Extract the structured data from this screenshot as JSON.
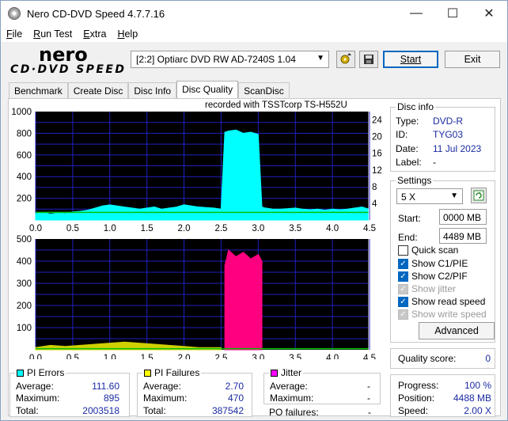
{
  "window": {
    "title": "Nero CD-DVD Speed 4.7.7.16",
    "minimize": "—",
    "maximize": "☐",
    "close": "✕"
  },
  "menu": [
    {
      "label": "File",
      "key": "F",
      "rest": "ile"
    },
    {
      "label": "Run Test",
      "key": "R",
      "rest": "un Test"
    },
    {
      "label": "Extra",
      "key": "E",
      "rest": "xtra"
    },
    {
      "label": "Help",
      "key": "H",
      "rest": "elp"
    }
  ],
  "logo": {
    "top": "nero",
    "bottom": "CD·DVD SPEED"
  },
  "toolbar": {
    "drive": "[2:2]  Optiarc DVD RW AD-7240S 1.04",
    "start_label": "Start",
    "exit_label": "Exit",
    "eject_icon": "eject-icon",
    "save_icon": "save-icon"
  },
  "tabs": [
    "Benchmark",
    "Create Disc",
    "Disc Info",
    "Disc Quality",
    "ScanDisc"
  ],
  "active_tab": "Disc Quality",
  "chart_data": [
    {
      "type": "area",
      "title": "recorded with TSSTcorp TS-H552U",
      "x_ticks": [
        "0.0",
        "0.5",
        "1.0",
        "1.5",
        "2.0",
        "2.5",
        "3.0",
        "3.5",
        "4.0",
        "4.5"
      ],
      "xlim": [
        0,
        4.5
      ],
      "y_ticks_left": [
        "1000",
        "800",
        "600",
        "400",
        "200"
      ],
      "ylim": [
        0,
        1000
      ],
      "y_ticks_right": [
        "24",
        "20",
        "16",
        "12",
        "8",
        "4"
      ],
      "y2lim": [
        0,
        26
      ],
      "grid": true,
      "series": [
        {
          "color": "#00ffff",
          "x": [
            0.0,
            0.1,
            0.2,
            0.3,
            0.4,
            0.5,
            0.6,
            0.7,
            0.8,
            0.9,
            1.0,
            1.1,
            1.2,
            1.3,
            1.4,
            1.5,
            1.6,
            1.7,
            1.8,
            1.9,
            2.0,
            2.1,
            2.2,
            2.3,
            2.4,
            2.5,
            2.55,
            2.6,
            2.7,
            2.8,
            2.9,
            3.0,
            3.05,
            3.1,
            3.2,
            3.3,
            3.4,
            3.5,
            3.6,
            3.7,
            3.8,
            3.9,
            4.0,
            4.1,
            4.2,
            4.3,
            4.4,
            4.49
          ],
          "y": [
            60,
            70,
            55,
            65,
            60,
            75,
            80,
            90,
            110,
            130,
            140,
            130,
            120,
            110,
            100,
            110,
            120,
            100,
            110,
            120,
            140,
            130,
            120,
            115,
            110,
            100,
            810,
            820,
            830,
            800,
            810,
            790,
            120,
            110,
            100,
            100,
            105,
            110,
            100,
            95,
            100,
            90,
            100,
            95,
            100,
            110,
            120,
            100
          ]
        },
        {
          "color": "#00c000",
          "x": [
            0.0,
            4.49
          ],
          "y": [
            70,
            70
          ]
        }
      ]
    },
    {
      "type": "area",
      "x_ticks": [
        "0.0",
        "0.5",
        "1.0",
        "1.5",
        "2.0",
        "2.5",
        "3.0",
        "3.5",
        "4.0",
        "4.5"
      ],
      "xlim": [
        0,
        4.5
      ],
      "y_ticks_left": [
        "500",
        "400",
        "300",
        "200",
        "100"
      ],
      "ylim": [
        0,
        500
      ],
      "grid": true,
      "series": [
        {
          "color": "#ff0080",
          "x": [
            2.55,
            2.6,
            2.7,
            2.8,
            2.9,
            3.0,
            3.05
          ],
          "y": [
            380,
            450,
            420,
            440,
            410,
            430,
            400
          ]
        },
        {
          "color": "#d0d000",
          "x": [
            0.0,
            0.2,
            0.4,
            0.6,
            0.8,
            1.0,
            1.2,
            1.4,
            1.6,
            1.8,
            2.0,
            2.2,
            2.4,
            2.5
          ],
          "y": [
            10,
            20,
            15,
            20,
            25,
            30,
            35,
            30,
            25,
            20,
            15,
            10,
            10,
            10
          ]
        },
        {
          "color": "#00c000",
          "x": [
            0.0,
            4.49
          ],
          "y": [
            5,
            5
          ]
        }
      ]
    }
  ],
  "disc_info": {
    "title": "Disc info",
    "type_label": "Type:",
    "type": "DVD-R",
    "id_label": "ID:",
    "id": "TYG03",
    "date_label": "Date:",
    "date": "11 Jul 2023",
    "label_label": "Label:",
    "label": "-"
  },
  "settings": {
    "title": "Settings",
    "speed": "5 X",
    "start_label": "Start:",
    "start": "0000 MB",
    "end_label": "End:",
    "end": "4489 MB",
    "quick_scan": "Quick scan",
    "show_c1": "Show C1/PIE",
    "show_c2": "Show C2/PIF",
    "show_jitter": "Show jitter",
    "show_read": "Show read speed",
    "show_write": "Show write speed",
    "advanced": "Advanced"
  },
  "quality": {
    "label": "Quality score:",
    "value": "0"
  },
  "progress": {
    "progress_label": "Progress:",
    "progress": "100 %",
    "position_label": "Position:",
    "position": "4488 MB",
    "speed_label": "Speed:",
    "speed": "2.00 X"
  },
  "pi_errors": {
    "title": "PI Errors",
    "color": "#00ffff",
    "avg_label": "Average:",
    "avg": "111.60",
    "max_label": "Maximum:",
    "max": "895",
    "total_label": "Total:",
    "total": "2003518"
  },
  "pi_failures": {
    "title": "PI Failures",
    "color": "#ffff00",
    "avg_label": "Average:",
    "avg": "2.70",
    "max_label": "Maximum:",
    "max": "470",
    "total_label": "Total:",
    "total": "387542"
  },
  "jitter": {
    "title": "Jitter",
    "color": "#ff00ff",
    "avg_label": "Average:",
    "avg": "-",
    "max_label": "Maximum:",
    "max": "-",
    "po_label": "PO failures:",
    "po": "-"
  }
}
